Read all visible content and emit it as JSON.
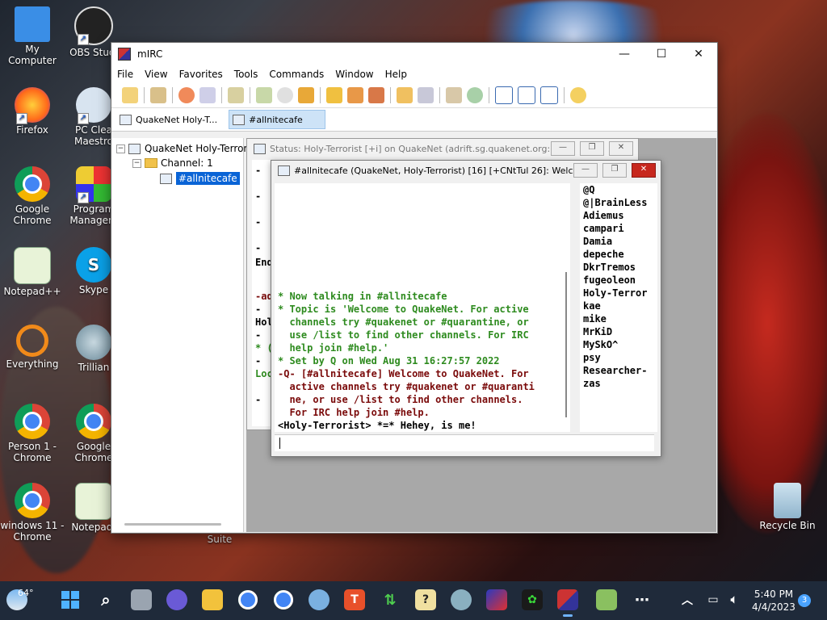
{
  "desktop": {
    "icons": [
      {
        "label": "My Computer"
      },
      {
        "label": "OBS Studi"
      },
      {
        "label": "Firefox"
      },
      {
        "label": "PC Clea Maestro"
      },
      {
        "label": "Google Chrome"
      },
      {
        "label": "Program Managem"
      },
      {
        "label": "Notepad++"
      },
      {
        "label": "Skype"
      },
      {
        "label": "Everything"
      },
      {
        "label": "Trillian"
      },
      {
        "label": "Person 1 - Chrome"
      },
      {
        "label": "Google Chrome"
      },
      {
        "label": "windows 11 - Chrome"
      },
      {
        "label": "Notepad-"
      },
      {
        "label": "Suite"
      },
      {
        "label": "Recycle Bin"
      }
    ]
  },
  "window": {
    "title": "mIRC",
    "minimize": "—",
    "maximize": "☐",
    "close": "✕"
  },
  "menu": [
    "File",
    "View",
    "Favorites",
    "Tools",
    "Commands",
    "Window",
    "Help"
  ],
  "switchbar": {
    "tabs": [
      {
        "label": "QuakeNet Holy-T..."
      },
      {
        "label": "#allnitecafe"
      }
    ]
  },
  "tree": {
    "network": "QuakeNet Holy-Terrori",
    "folder": "Channel: 1",
    "channel": "#allnitecafe"
  },
  "status_window": {
    "title": "Status: Holy-Terrorist [+i] on QuakeNet (adrift.sg.quakenet.org:...",
    "fragments": [
      "-",
      "-",
      "-",
      "-",
      "End",
      "-ad",
      "-",
      "Hol",
      "-",
      "* (",
      "-",
      "Loc",
      "-"
    ]
  },
  "channel_window": {
    "title": "#allnitecafe (QuakeNet, Holy-Terrorist) [16] [+CNtTul 26]: Welc...",
    "messages": [
      {
        "text": "* Now talking in #allnitecafe",
        "color": "green"
      },
      {
        "text": "* Topic is 'Welcome to QuakeNet. For active\n  channels try #quakenet or #quarantine, or\n  use /list to find other channels. For IRC\n  help join #help.'",
        "color": "green"
      },
      {
        "text": "* Set by Q on Wed Aug 31 16:27:57 2022",
        "color": "green"
      },
      {
        "text": "-Q- [#allnitecafe] Welcome to QuakeNet. For\n  active channels try #quakenet or #quaranti\n  ne, or use /list to find other channels.\n  For IRC help join #help.",
        "color": "maroon"
      },
      {
        "text": "<Holy-Terrorist> *=* Hehey, is me!",
        "color": "black"
      }
    ],
    "nicks": [
      "@Q",
      "@|BrainLess",
      "Adiemus",
      "campari",
      "Damia",
      "depeche",
      "DkrTremos",
      "fugeoleon",
      "Holy-Terror",
      "kae",
      "mike",
      "MrKiD",
      "MySkO^",
      "psy",
      "Researcher-",
      "zas"
    ]
  },
  "taskbar": {
    "weather": "64°",
    "time": "5:40 PM",
    "date": "4/4/2023",
    "notifications": "3"
  },
  "colors": {
    "accent": "#0a64d6",
    "green_text": "#2e8b1f",
    "maroon_text": "#7a0a0a",
    "close_red": "#c7281e"
  }
}
